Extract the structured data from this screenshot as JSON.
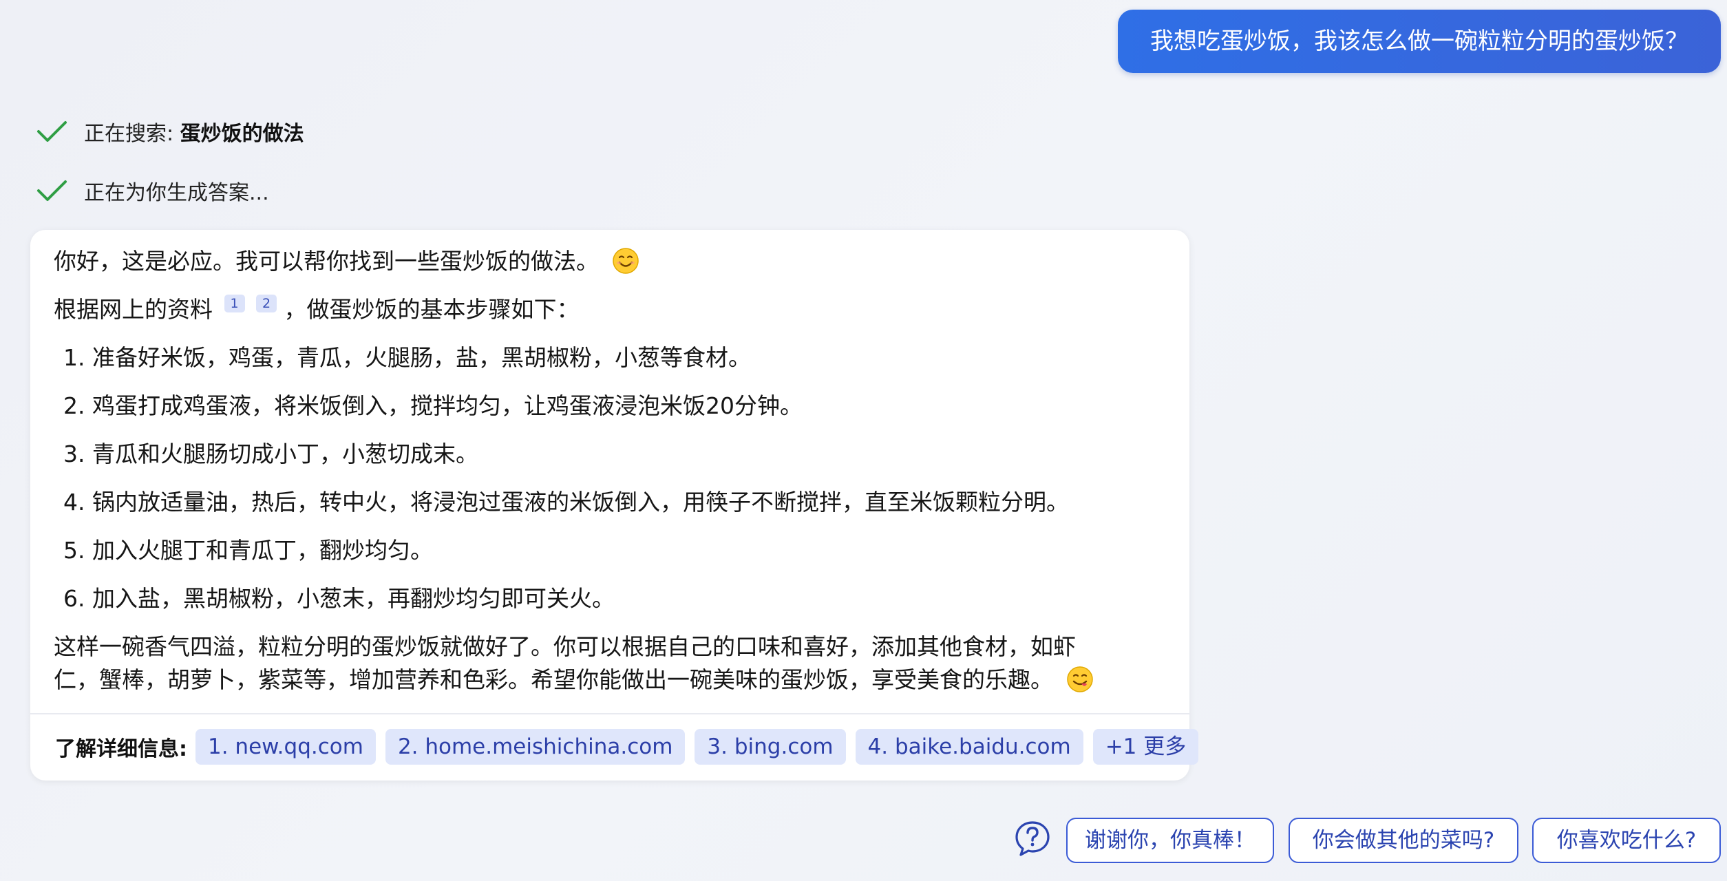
{
  "user_message": "我想吃蛋炒饭，我该怎么做一碗粒粒分明的蛋炒饭？",
  "status": {
    "searching_prefix": "正在搜索:",
    "searching_query": "蛋炒饭的做法",
    "generating": "正在为你生成答案..."
  },
  "answer": {
    "greeting": "你好，这是必应。我可以帮你找到一些蛋炒饭的做法。",
    "intro_before": "根据网上的资料",
    "citations": [
      "1",
      "2"
    ],
    "intro_after": "，做蛋炒饭的基本步骤如下：",
    "steps": [
      "1. 准备好米饭，鸡蛋，青瓜，火腿肠，盐，黑胡椒粉，小葱等食材。",
      "2. 鸡蛋打成鸡蛋液，将米饭倒入，搅拌均匀，让鸡蛋液浸泡米饭20分钟。",
      "3. 青瓜和火腿肠切成小丁，小葱切成末。",
      "4. 锅内放适量油，热后，转中火，将浸泡过蛋液的米饭倒入，用筷子不断搅拌，直至米饭颗粒分明。",
      "5. 加入火腿丁和青瓜丁，翻炒均匀。",
      "6. 加入盐，黑胡椒粉，小葱末，再翻炒均匀即可关火。"
    ],
    "closing_line1": "这样一碗香气四溢，粒粒分明的蛋炒饭就做好了。你可以根据自己的口味和喜好，添加其他食材，如虾",
    "closing_line2": "仁，蟹棒，胡萝卜，紫菜等，增加营养和色彩。希望你能做出一碗美味的蛋炒饭，享受美食的乐趣。"
  },
  "learn_more": {
    "label": "了解详细信息:",
    "sources": [
      "1. new.qq.com",
      "2. home.meishichina.com",
      "3. bing.com",
      "4. baike.baidu.com"
    ],
    "more": "+1 更多"
  },
  "suggestions": [
    "谢谢你，你真棒！",
    "你会做其他的菜吗?",
    "你喜欢吃什么?"
  ],
  "icons": {
    "check": "check-icon",
    "smile": "smiling-face-emoji",
    "yum": "face-savoring-food-emoji",
    "help": "question-bubble-icon"
  },
  "colors": {
    "user_bubble": "#2f6fe6",
    "check_green": "#2f9e44",
    "chip_bg": "#dfe6fb",
    "chip_text": "#2c3fa8",
    "suggest_border": "#3b5bd6"
  }
}
